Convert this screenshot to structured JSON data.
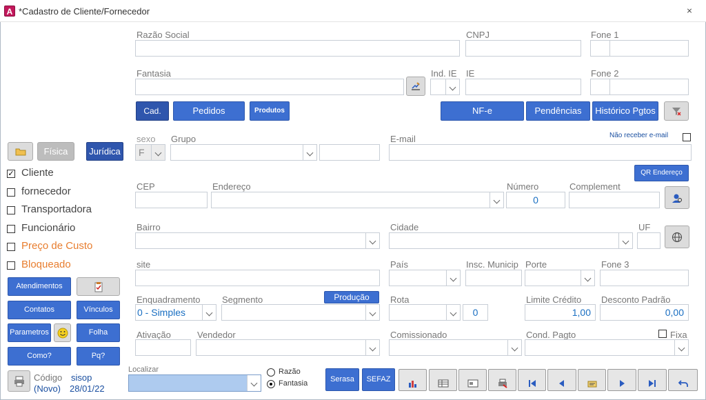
{
  "window": {
    "title": "*Cadastro de Cliente/Fornecedor",
    "app_icon_letter": "A",
    "close_glyph": "⨯"
  },
  "form": {
    "razao_social": {
      "label": "Razão Social",
      "value": ""
    },
    "cnpj": {
      "label": "CNPJ",
      "value": ""
    },
    "fone1": {
      "label": "Fone 1",
      "value": ""
    },
    "fantasia": {
      "label": "Fantasia",
      "value": ""
    },
    "ind_ie": {
      "label": "Ind. IE",
      "value": ""
    },
    "ie": {
      "label": "IE",
      "value": ""
    },
    "fone2": {
      "label": "Fone 2",
      "value": ""
    },
    "sexo": {
      "label": "sexo",
      "value": "F"
    },
    "grupo": {
      "label": "Grupo",
      "value": ""
    },
    "email": {
      "label": "E-mail",
      "value": ""
    },
    "nao_receber_email": {
      "label": "Não receber e-mail",
      "checked": false
    },
    "cep": {
      "label": "CEP",
      "value": ""
    },
    "endereco": {
      "label": "Endereço",
      "value": ""
    },
    "numero": {
      "label": "Número",
      "value": "0"
    },
    "complemento": {
      "label": "Complement",
      "value": ""
    },
    "bairro": {
      "label": "Bairro",
      "value": ""
    },
    "cidade": {
      "label": "Cidade",
      "value": ""
    },
    "uf": {
      "label": "UF",
      "value": ""
    },
    "site": {
      "label": "site",
      "value": ""
    },
    "pais": {
      "label": "País",
      "value": ""
    },
    "insc_municip": {
      "label": "Insc. Municip",
      "value": ""
    },
    "porte": {
      "label": "Porte",
      "value": ""
    },
    "fone3": {
      "label": "Fone 3",
      "value": ""
    },
    "enquadramento": {
      "label": "Enquadramento",
      "value": "0 - Simples"
    },
    "segmento": {
      "label": "Segmento",
      "value": ""
    },
    "rota": {
      "label": "Rota",
      "value": "",
      "num": "0"
    },
    "limite_credito": {
      "label": "Limite Crédito",
      "value": "1,00"
    },
    "desconto_padrao": {
      "label": "Desconto Padrão",
      "value": "0,00"
    },
    "ativacao": {
      "label": "Ativação",
      "value": ""
    },
    "vendedor": {
      "label": "Vendedor",
      "value": ""
    },
    "comissionado": {
      "label": "Comissionado",
      "value": ""
    },
    "cond_pagto": {
      "label": "Cond. Pagto",
      "value": ""
    },
    "fixa": {
      "label": "Fixa",
      "checked": false
    }
  },
  "buttons": {
    "cad": "Cad.",
    "pedidos": "Pedidos",
    "produtos": "Produtos",
    "nfe": "NF-e",
    "pendencias": "Pendências",
    "historico": "Histórico Pgtos",
    "qr_endereco": "QR Endereço",
    "producao": "Produção",
    "fisica": "Física",
    "juridica": "Jurídica",
    "atendimentos": "Atendimentos",
    "contatos": "Contatos",
    "vinculos": "Vínculos",
    "parametros": "Parametros",
    "folha": "Folha",
    "como": "Como?",
    "pq": "Pq?",
    "serasa": "Serasa",
    "sefaz": "SEFAZ"
  },
  "sidebar": {
    "checks": [
      {
        "label": "Cliente",
        "checked": true,
        "color": "#444444"
      },
      {
        "label": "fornecedor",
        "checked": false,
        "color": "#444444"
      },
      {
        "label": "Transportadora",
        "checked": false,
        "color": "#444444"
      },
      {
        "label": "Funcionário",
        "checked": false,
        "color": "#444444"
      },
      {
        "label": "Preço de Custo",
        "checked": false,
        "color": "#e87d2e"
      },
      {
        "label": "Bloqueado",
        "checked": false,
        "color": "#e87d2e"
      }
    ],
    "codigo_label": "Código",
    "codigo_value": "(Novo)",
    "user": "sisop",
    "date": "28/01/22"
  },
  "bottom": {
    "localizar_label": "Localizar",
    "localizar_value": "",
    "radio_razao": "Razão",
    "radio_fantasia": "Fantasia",
    "selected": "Fantasia",
    "nav_icons": [
      "chart-icon",
      "grid-icon",
      "card-icon",
      "print-icon",
      "first-icon",
      "prev-icon",
      "edit-icon",
      "next-icon",
      "last-icon",
      "undo-icon"
    ]
  },
  "colors": {
    "accent": "#3d6fd1",
    "accent_dark": "#2f56ad",
    "value_blue": "#1a6fc2",
    "warning": "#e87d2e",
    "localizar_bg": "#aecbef"
  }
}
